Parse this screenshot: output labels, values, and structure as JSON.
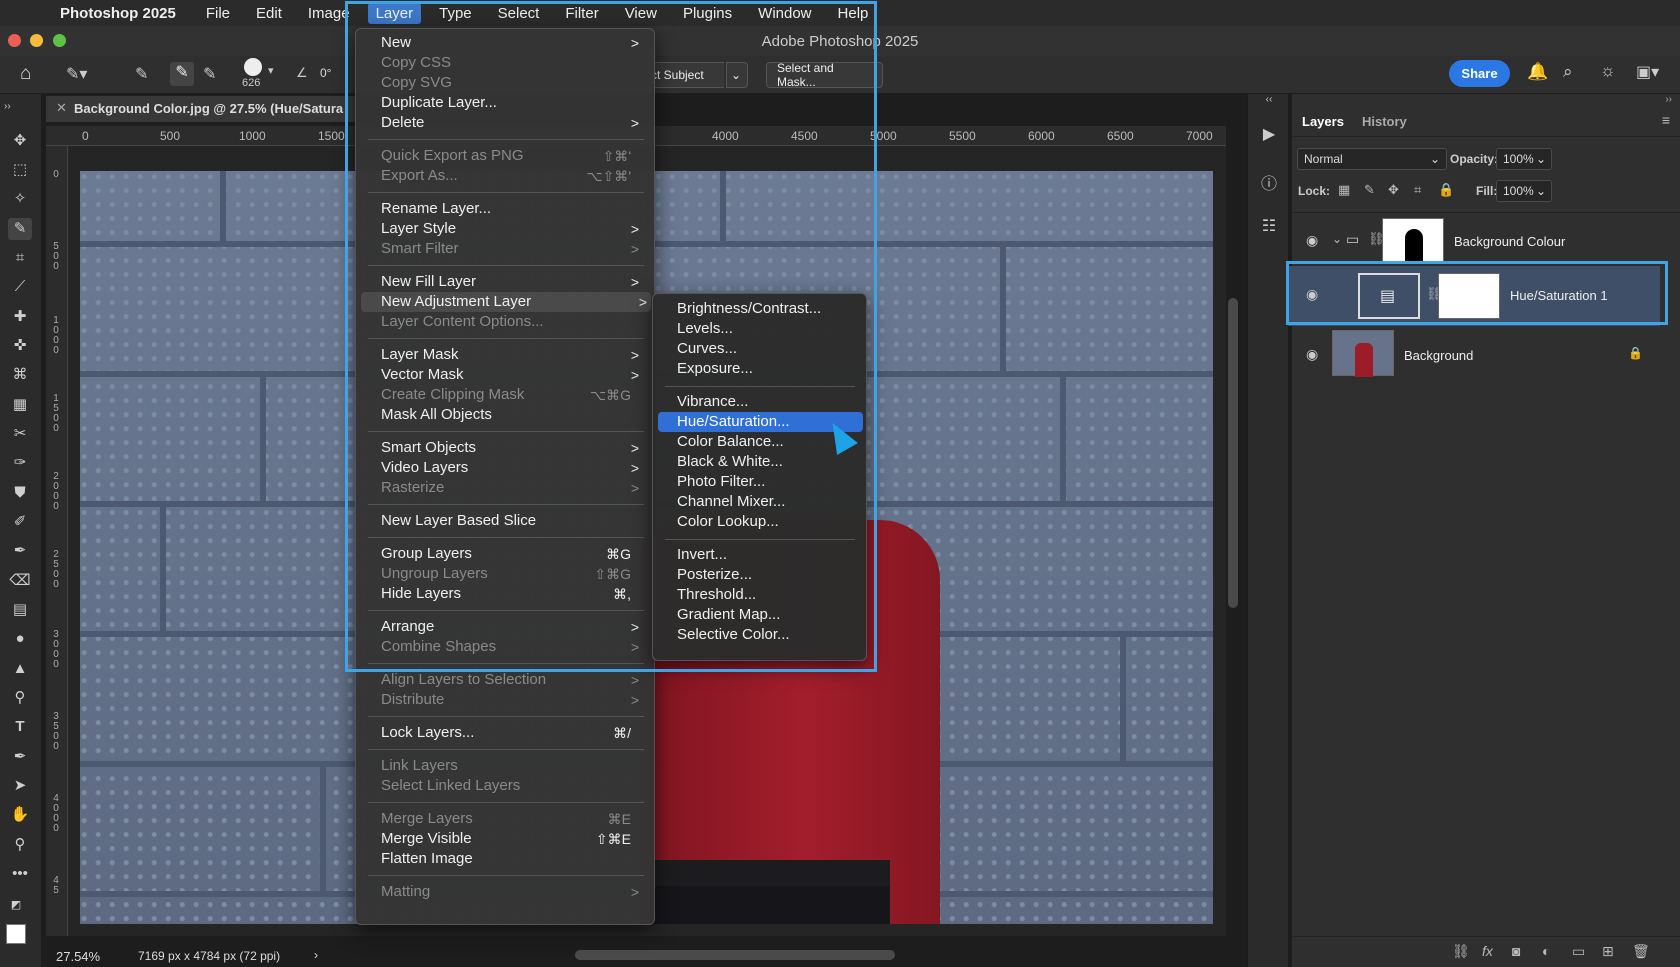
{
  "menubar": {
    "app_name": "Photoshop 2025",
    "items": [
      "File",
      "Edit",
      "Image",
      "Layer",
      "Type",
      "Select",
      "Filter",
      "View",
      "Plugins",
      "Window",
      "Help"
    ],
    "active": "Layer"
  },
  "window": {
    "title": "Adobe Photoshop 2025"
  },
  "options": {
    "brush_size": "626",
    "angle": "0°",
    "select_subject_label": "ct Subject",
    "select_mask_label": "Select and Mask...",
    "share_label": "Share"
  },
  "document": {
    "tab_title": "Background Color.jpg @ 27.5% (Hue/Satura",
    "ruler_top": [
      "0",
      "500",
      "1000",
      "1500",
      "4000",
      "4500",
      "5000",
      "5500",
      "6000",
      "6500",
      "7000"
    ],
    "ruler_left": [
      "0",
      "5 0 0",
      "1 0 0 0",
      "1 5 0 0",
      "2 0 0 0",
      "2 5 0 0",
      "3 0 0 0",
      "3 5 0 0",
      "4 0 0 0",
      "4 5"
    ],
    "zoom": "27.54%",
    "info": "7169 px x 4784 px (72 ppi)"
  },
  "layers_panel": {
    "tabs": [
      "Layers",
      "History"
    ],
    "blend_mode": "Normal",
    "opacity_label": "Opacity:",
    "opacity": "100%",
    "lock_label": "Lock:",
    "fill_label": "Fill:",
    "fill": "100%",
    "layers": [
      {
        "name": "Background Colour"
      },
      {
        "name": "Hue/Saturation 1"
      },
      {
        "name": "Background"
      }
    ]
  },
  "layer_menu": {
    "items": [
      {
        "label": "New",
        "arrow": ">"
      },
      {
        "label": "Copy CSS",
        "disabled": true
      },
      {
        "label": "Copy SVG",
        "disabled": true
      },
      {
        "label": "Duplicate Layer..."
      },
      {
        "label": "Delete",
        "arrow": ">"
      },
      {
        "label": "Quick Export as PNG",
        "shortcut": "⇧⌘'",
        "disabled": true
      },
      {
        "label": "Export As...",
        "shortcut": "⌥⇧⌘'",
        "disabled": true
      },
      {
        "label": "Rename Layer..."
      },
      {
        "label": "Layer Style",
        "arrow": ">"
      },
      {
        "label": "Smart Filter",
        "arrow": ">",
        "disabled": true
      },
      {
        "label": "New Fill Layer",
        "arrow": ">"
      },
      {
        "label": "New Adjustment Layer",
        "arrow": ">"
      },
      {
        "label": "Layer Content Options...",
        "disabled": true
      },
      {
        "label": "Layer Mask",
        "arrow": ">"
      },
      {
        "label": "Vector Mask",
        "arrow": ">"
      },
      {
        "label": "Create Clipping Mask",
        "shortcut": "⌥⌘G",
        "disabled": true
      },
      {
        "label": "Mask All Objects"
      },
      {
        "label": "Smart Objects",
        "arrow": ">"
      },
      {
        "label": "Video Layers",
        "arrow": ">"
      },
      {
        "label": "Rasterize",
        "arrow": ">",
        "disabled": true
      },
      {
        "label": "New Layer Based Slice"
      },
      {
        "label": "Group Layers",
        "shortcut": "⌘G"
      },
      {
        "label": "Ungroup Layers",
        "shortcut": "⇧⌘G",
        "disabled": true
      },
      {
        "label": "Hide Layers",
        "shortcut": "⌘,"
      },
      {
        "label": "Arrange",
        "arrow": ">"
      },
      {
        "label": "Combine Shapes",
        "arrow": ">",
        "disabled": true
      },
      {
        "label": "Align Layers to Selection",
        "arrow": ">",
        "disabled": true
      },
      {
        "label": "Distribute",
        "arrow": ">",
        "disabled": true
      },
      {
        "label": "Lock Layers...",
        "shortcut": "⌘/"
      },
      {
        "label": "Link Layers",
        "disabled": true
      },
      {
        "label": "Select Linked Layers",
        "disabled": true
      },
      {
        "label": "Merge Layers",
        "shortcut": "⌘E",
        "disabled": true
      },
      {
        "label": "Merge Visible",
        "shortcut": "⇧⌘E"
      },
      {
        "label": "Flatten Image"
      },
      {
        "label": "Matting",
        "arrow": ">",
        "disabled": true
      }
    ]
  },
  "adjustment_submenu": {
    "items": [
      "Brightness/Contrast...",
      "Levels...",
      "Curves...",
      "Exposure...",
      "Vibrance...",
      "Hue/Saturation...",
      "Color Balance...",
      "Black & White...",
      "Photo Filter...",
      "Channel Mixer...",
      "Color Lookup...",
      "Invert...",
      "Posterize...",
      "Threshold...",
      "Gradient Map...",
      "Selective Color..."
    ],
    "selected": "Hue/Saturation..."
  },
  "colors": {
    "accent": "#3fa3e6",
    "selection": "#2f6fd6",
    "share": "#2b78e4"
  }
}
